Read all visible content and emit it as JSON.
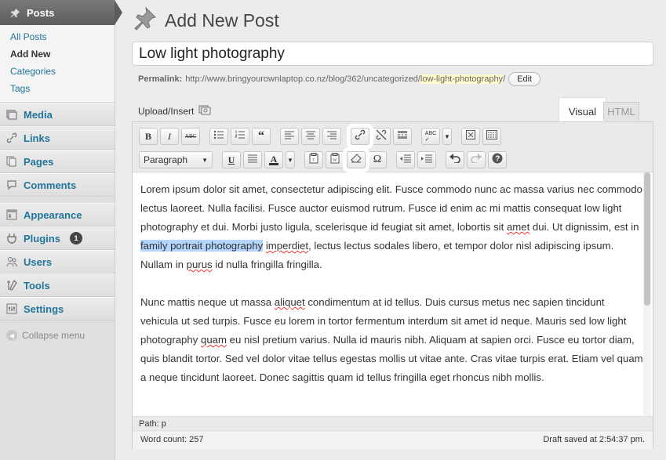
{
  "sidebar": {
    "posts_label": "Posts",
    "sub_items": [
      "All Posts",
      "Add New",
      "Categories",
      "Tags"
    ],
    "items": [
      {
        "label": "Media",
        "icon": "media-icon"
      },
      {
        "label": "Links",
        "icon": "links-icon"
      },
      {
        "label": "Pages",
        "icon": "pages-icon"
      },
      {
        "label": "Comments",
        "icon": "comments-icon"
      },
      {
        "label": "Appearance",
        "icon": "appearance-icon"
      },
      {
        "label": "Plugins",
        "icon": "plugins-icon",
        "badge": "1"
      },
      {
        "label": "Users",
        "icon": "users-icon"
      },
      {
        "label": "Tools",
        "icon": "tools-icon"
      },
      {
        "label": "Settings",
        "icon": "settings-icon"
      }
    ],
    "collapse_label": "Collapse menu"
  },
  "header": {
    "title": "Add New Post"
  },
  "post": {
    "title_value": "Low light photography",
    "permalink_label": "Permalink:",
    "permalink_base": "http://www.bringyourownlaptop.co.nz/blog/362/uncategorized/",
    "permalink_slug": "low-light-photography",
    "permalink_end": "/",
    "edit_label": "Edit"
  },
  "editor": {
    "upload_label": "Upload/Insert",
    "tab_visual": "Visual",
    "tab_html": "HTML",
    "format_select": "Paragraph",
    "para1": {
      "a": "Lorem ipsum dolor sit amet, consectetur adipiscing elit. Fusce commodo nunc ac massa varius nec commodo lectus laoreet. Nulla facilisi. Fusce auctor euismod rutrum. Fusce id enim ac mi mattis consequat low light photography et dui. Morbi justo ligula, scelerisque id feugiat sit amet, lobortis sit ",
      "amet": "amet",
      "b": " dui. Ut dignissim, est in ",
      "selected": "family portrait photography",
      "c": " ",
      "imperdiet": "imperdiet",
      "d": ", lectus lectus sodales libero, et tempor dolor nisl adipiscing ipsum. Nullam in ",
      "purus": "purus",
      "e": " id nulla fringilla fringilla."
    },
    "para2": {
      "a": "Nunc mattis neque ut massa ",
      "aliquet": "aliquet",
      "b": " condimentum at id tellus. Duis cursus metus nec sapien tincidunt vehicula ut sed turpis. Fusce eu lorem in tortor fermentum interdum sit amet id neque. Mauris sed low light photography ",
      "quam": "quam",
      "c": " eu nisl pretium varius. Nulla id mauris nibh. Aliquam at sapien orci. Fusce eu tortor diam, quis blandit tortor. Sed vel dolor vitae tellus egestas mollis ut vitae ante. Cras vitae turpis erat. Etiam vel quam a neque tincidunt laoreet. Donec sagittis quam id tellus fringilla eget rhoncus nibh mollis."
    },
    "path_label": "Path: p",
    "word_count": "Word count: 257",
    "draft_saved": "Draft saved at 2:54:37 pm."
  }
}
